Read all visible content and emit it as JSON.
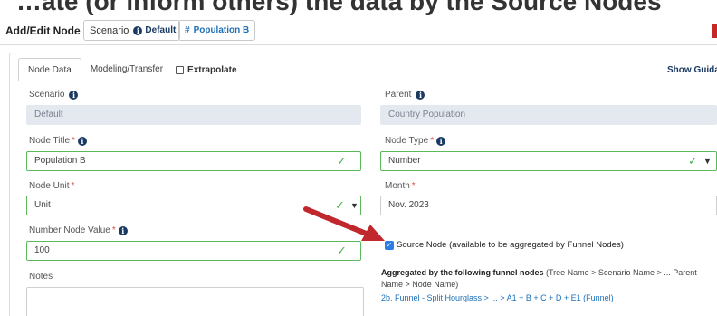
{
  "top_strip_text": "…ate (or inform others) the data by the Source Nodes",
  "header": {
    "title": "Add/Edit Node",
    "scenario_label": "Scenario",
    "scenario_value": "Default",
    "population_tag": "Population B",
    "population_icon": "hash-icon"
  },
  "tabs": {
    "node_data": "Node Data",
    "modeling_transfer": "Modeling/Transfer",
    "extrapolate": "Extrapolate"
  },
  "show_guidance": "Show Guidanc",
  "fields": {
    "scenario": {
      "label": "Scenario",
      "value": "Default"
    },
    "parent": {
      "label": "Parent",
      "value": "Country Population"
    },
    "node_title": {
      "label": "Node Title",
      "required": "*",
      "value": "Population B"
    },
    "node_type": {
      "label": "Node Type",
      "required": "*",
      "value": "Number"
    },
    "node_unit": {
      "label": "Node Unit",
      "required": "*",
      "value": "Unit"
    },
    "month": {
      "label": "Month",
      "required": "*",
      "value": "Nov. 2023"
    },
    "number_node_value": {
      "label": "Number Node Value",
      "required": "*",
      "value": "100"
    },
    "notes": {
      "label": "Notes",
      "value": ""
    }
  },
  "source_node_label": "Source Node (available to be aggregated by Funnel Nodes)",
  "source_node_checked": true,
  "aggregated": {
    "bold": "Aggregated by the following funnel nodes",
    "rest": " (Tree Name > Scenario Name > ... Parent Name > Node Name)",
    "link": "2b. Funnel - Split Hourglass > ... > A1 + B + C + D + E1 (Funnel)"
  },
  "colors": {
    "valid_border": "#5cb85c",
    "readonly_bg": "#e4e9ef",
    "link": "#1d6fb8",
    "arrow": "#c0282d"
  }
}
